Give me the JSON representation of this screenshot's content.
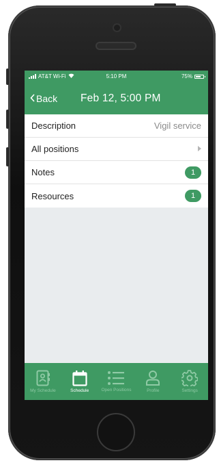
{
  "status_bar": {
    "carrier": "AT&T Wi-Fi",
    "time": "5:10 PM",
    "battery": "75%",
    "battery_level": 0.75
  },
  "nav": {
    "back_label": "Back",
    "title": "Feb 12, 5:00 PM"
  },
  "rows": [
    {
      "label": "Description",
      "value": "Vigil service"
    },
    {
      "label": "All positions"
    },
    {
      "label": "Notes",
      "count": "1"
    },
    {
      "label": "Resources",
      "count": "1"
    }
  ],
  "tabs": [
    {
      "label": "My Schedule",
      "icon": "contact-card-icon"
    },
    {
      "label": "Schedule",
      "icon": "calendar-icon",
      "active": true
    },
    {
      "label": "Open Positions",
      "icon": "list-icon"
    },
    {
      "label": "Profile",
      "icon": "person-icon"
    },
    {
      "label": "Settings",
      "icon": "gear-icon"
    }
  ],
  "colors": {
    "brand_green": "#3f9a63",
    "inactive_tab": "#8fcaa5",
    "background": "#e9ecee"
  }
}
